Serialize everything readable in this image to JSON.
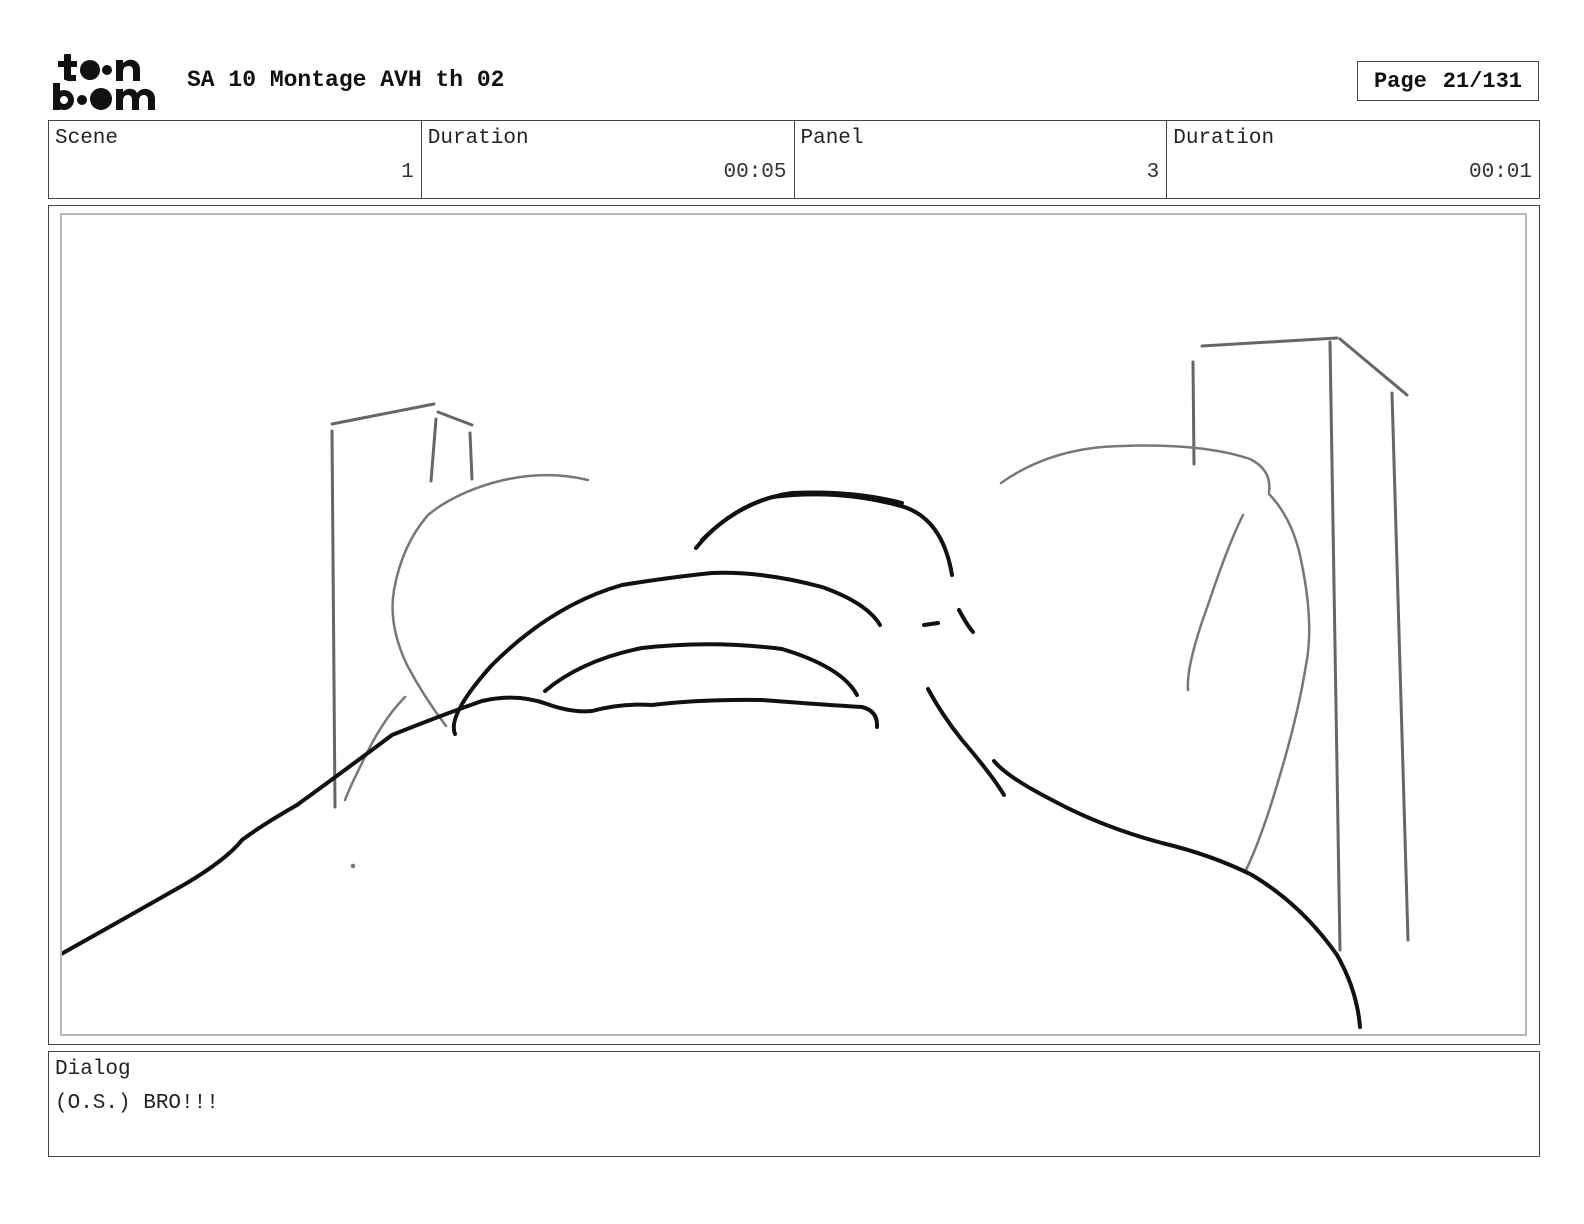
{
  "header": {
    "logo": {
      "line1": "toon",
      "line2": "boom"
    },
    "title": "SA 10 Montage AVH th 02",
    "page_label": "Page",
    "page_value": "21/131"
  },
  "info": {
    "scene_label": "Scene",
    "scene_value": "1",
    "scene_duration_label": "Duration",
    "scene_duration_value": "00:05",
    "panel_label": "Panel",
    "panel_value": "3",
    "panel_duration_label": "Duration",
    "panel_duration_value": "00:01"
  },
  "dialog": {
    "label": "Dialog",
    "text": "(O.S.) BRO!!!"
  }
}
